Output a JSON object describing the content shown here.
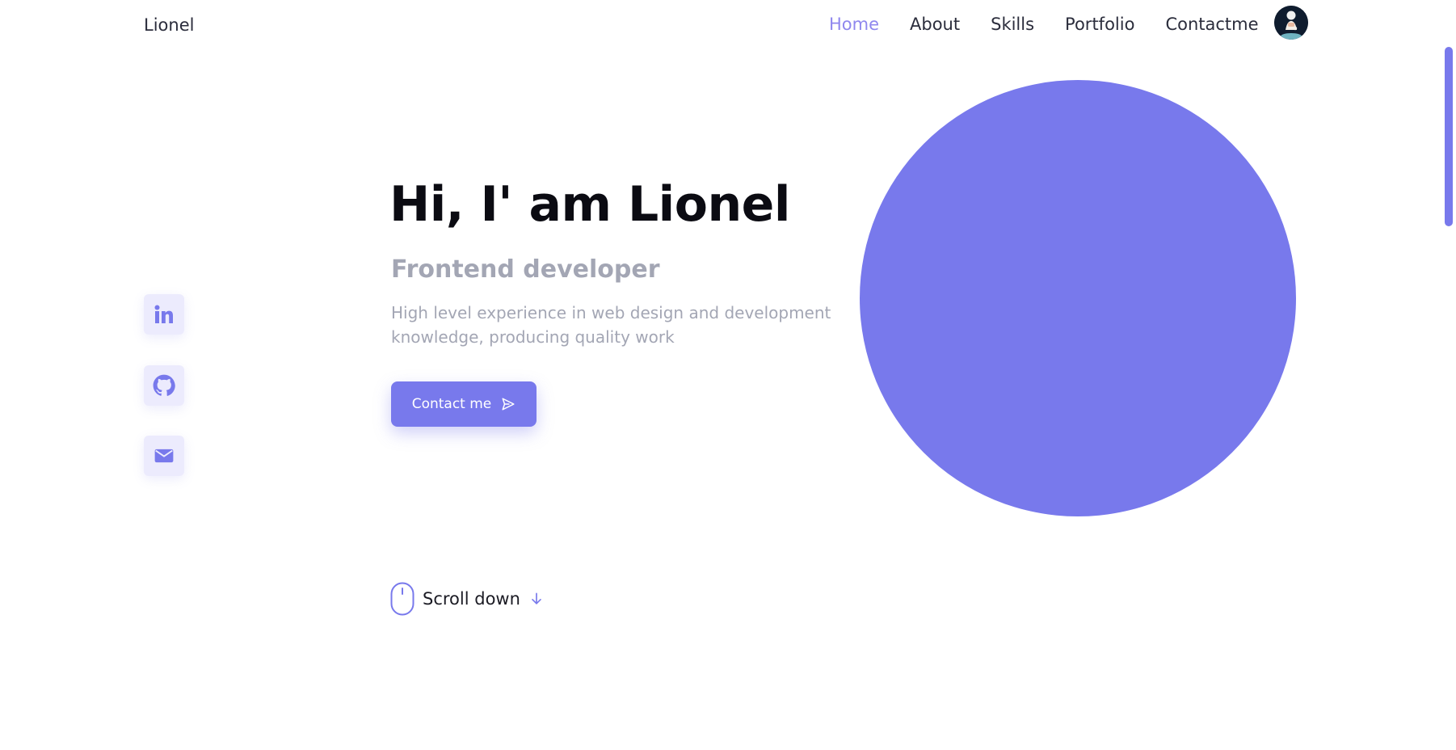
{
  "header": {
    "brand": "Lionel",
    "nav": [
      {
        "label": "Home",
        "active": true
      },
      {
        "label": "About",
        "active": false
      },
      {
        "label": "Skills",
        "active": false
      },
      {
        "label": "Portfolio",
        "active": false
      },
      {
        "label": "Contactme",
        "active": false
      }
    ],
    "avatar_icon": "user-avatar"
  },
  "social": [
    {
      "icon": "linkedin-icon"
    },
    {
      "icon": "github-icon"
    },
    {
      "icon": "mail-icon"
    }
  ],
  "hero": {
    "title": "Hi, I' am Lionel",
    "subtitle": "Frontend developer",
    "description": "High level experience in web design and development knowledge, producing quality work",
    "cta_label": "Contact me",
    "cta_icon": "send-icon"
  },
  "scroll": {
    "label": "Scroll down",
    "mouse_icon": "mouse-icon",
    "arrow_icon": "arrow-down-icon"
  },
  "colors": {
    "accent": "#7879ec",
    "accent_light": "#ecebfd",
    "nav_active": "#8f87ee",
    "text_dark": "#0b0b12",
    "text_muted": "#a3a6b4"
  }
}
